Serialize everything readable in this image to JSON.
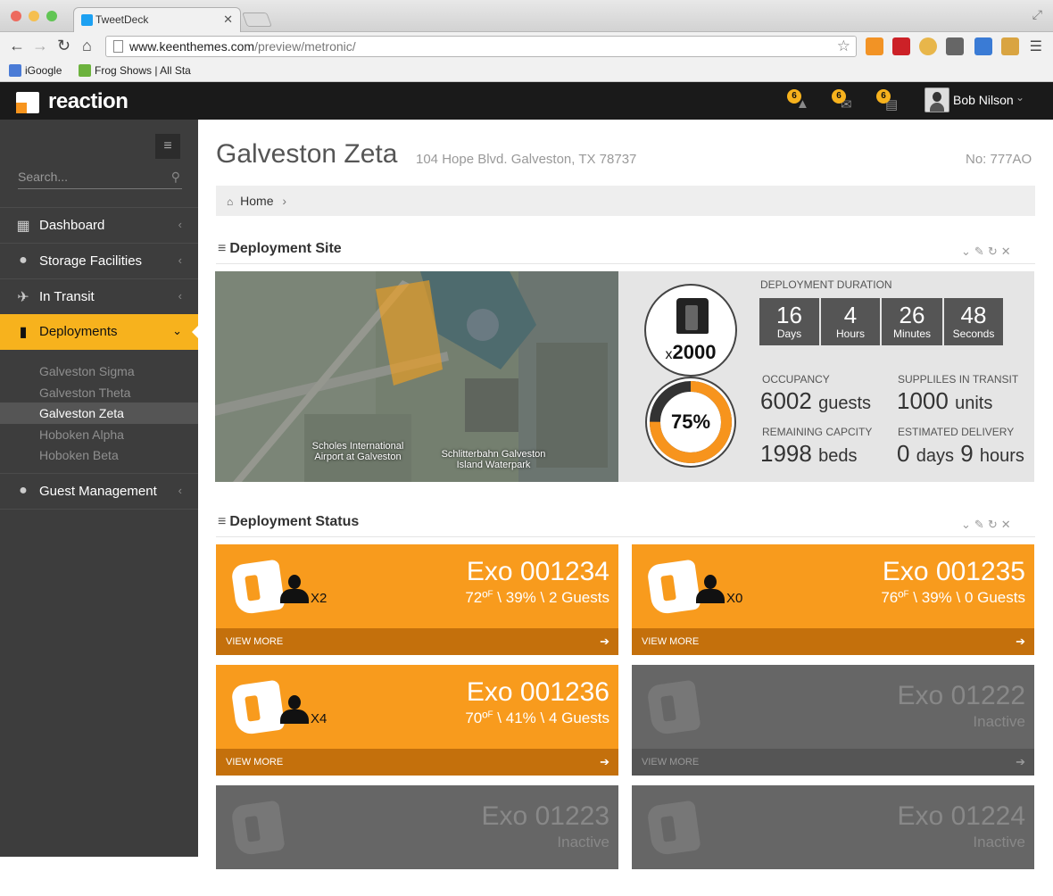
{
  "browser": {
    "tab_title": "TweetDeck",
    "url_host": "www.keenthemes.com",
    "url_path": "/preview/metronic/",
    "bookmarks": [
      "iGoogle",
      "Frog Shows | All Sta"
    ]
  },
  "app": {
    "brand": "reaction",
    "notifications": [
      {
        "count": "6",
        "icon": "warning-icon"
      },
      {
        "count": "6",
        "icon": "inbox-icon"
      },
      {
        "count": "6",
        "icon": "tasks-icon"
      }
    ],
    "user_name": "Bob Nilson"
  },
  "sidebar": {
    "search_placeholder": "Search...",
    "items": [
      {
        "label": "Dashboard",
        "icon": "grid-icon"
      },
      {
        "label": "Storage Facilities",
        "icon": "map-pin-icon"
      },
      {
        "label": "In Transit",
        "icon": "plane-icon"
      },
      {
        "label": "Deployments",
        "icon": "pod-icon"
      },
      {
        "label": "Guest Management",
        "icon": "user-icon"
      }
    ],
    "deployments": [
      "Galveston Sigma",
      "Galveston Theta",
      "Galveston Zeta",
      "Hoboken Alpha",
      "Hoboken Beta"
    ],
    "active_deployment": "Galveston Zeta"
  },
  "page": {
    "title": "Galveston Zeta",
    "address": "104 Hope Blvd.  Galveston, TX  78737",
    "number": "No:  777AO",
    "breadcrumb": "Home"
  },
  "site": {
    "section_title": "Deployment Site",
    "map_labels": [
      "Scholes International Airport at Galveston",
      "Schlitterbahn Galveston Island Waterpark"
    ],
    "pod_prefix": "x",
    "pod_count": "2000",
    "capacity_percent": 75,
    "capacity_label": "75%",
    "duration_label": "DEPLOYMENT DURATION",
    "duration": [
      {
        "value": "16",
        "unit": "Days"
      },
      {
        "value": "4",
        "unit": "Hours"
      },
      {
        "value": "26",
        "unit": "Minutes"
      },
      {
        "value": "48",
        "unit": "Seconds"
      }
    ],
    "occupancy_label": "OCCUPANCY",
    "occupancy_value": "6002",
    "occupancy_unit": "guests",
    "supplies_label": "SUPPLILES IN TRANSIT",
    "supplies_value": "1000",
    "supplies_unit": "units",
    "remaining_label": "REMAINING CAPCITY",
    "remaining_value": "1998",
    "remaining_unit": "beds",
    "delivery_label": "ESTIMATED DELIVERY",
    "delivery_days": "0",
    "delivery_days_unit": "days",
    "delivery_hours": "9",
    "delivery_hours_unit": "hours"
  },
  "status": {
    "section_title": "Deployment Status",
    "view_more": "VIEW MORE",
    "cards": [
      {
        "name": "Exo 001234",
        "temp": "72º",
        "temp_unit": "F",
        "sep1": " \\ ",
        "humidity": "39%",
        "sep2": " \\ ",
        "guests": "2 Guests",
        "multiplier": "X2",
        "active": true
      },
      {
        "name": "Exo 001235",
        "temp": "76º",
        "temp_unit": "F",
        "sep1": " \\ ",
        "humidity": "39%",
        "sep2": " \\ ",
        "guests": "0 Guests",
        "multiplier": "X0",
        "active": true
      },
      {
        "name": "Exo 001236",
        "temp": "70º",
        "temp_unit": "F",
        "sep1": " \\ ",
        "humidity": "41%",
        "sep2": " \\ ",
        "guests": "4 Guests",
        "multiplier": "X4",
        "active": true
      },
      {
        "name": "Exo 01222",
        "status": "Inactive",
        "active": false
      },
      {
        "name": "Exo 01223",
        "status": "Inactive",
        "active": false
      },
      {
        "name": "Exo 01224",
        "status": "Inactive",
        "active": false
      }
    ]
  }
}
